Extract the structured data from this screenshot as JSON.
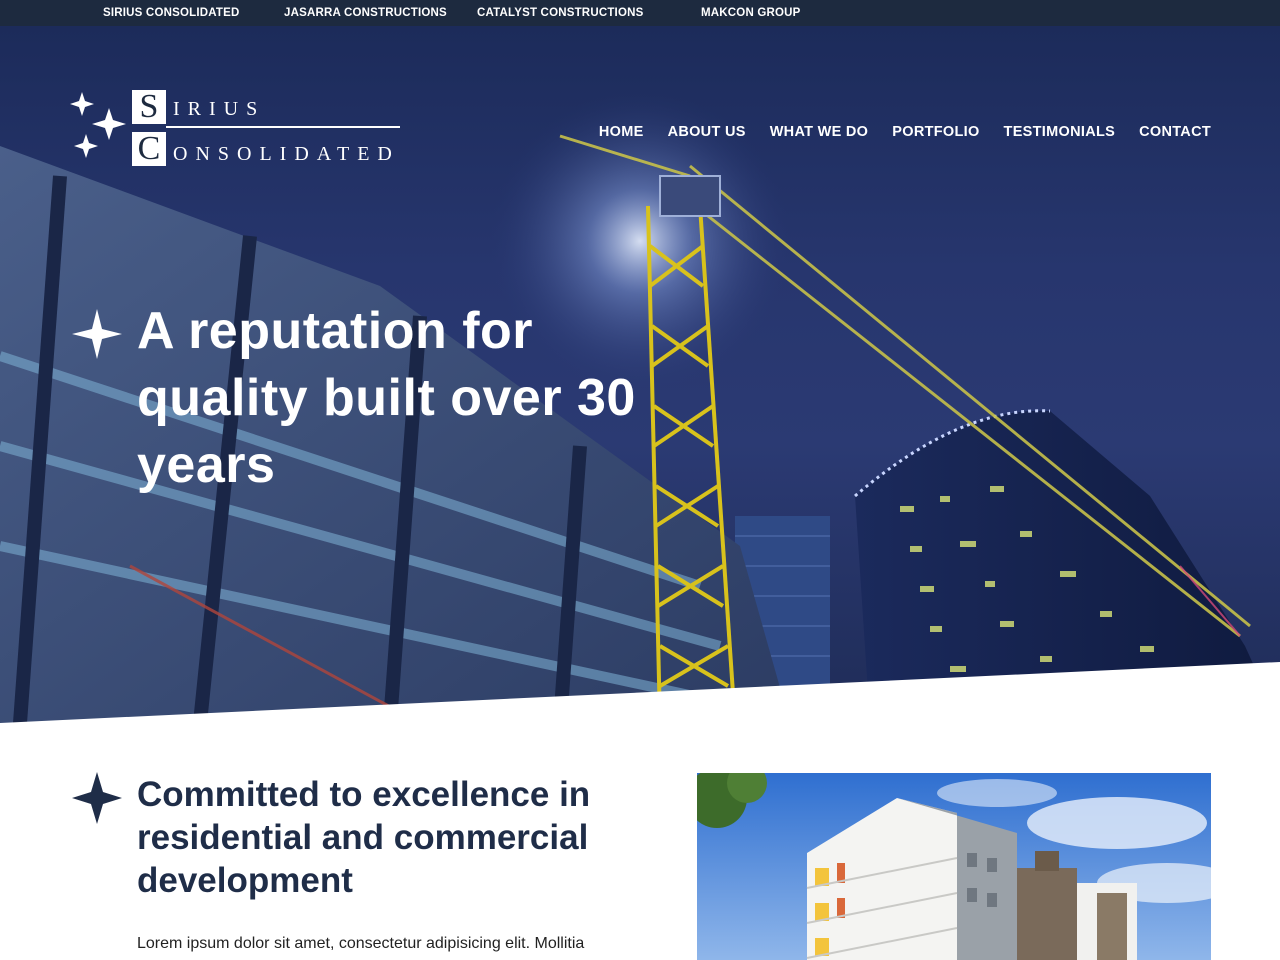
{
  "top_bar": {
    "links": [
      "SIRIUS CONSOLIDATED",
      "JASARRA CONSTRUCTIONS",
      "CATALYST CONSTRUCTIONS",
      "MAKCON GROUP"
    ]
  },
  "logo": {
    "initial_1": "S",
    "word_1": "IRIUS",
    "initial_2": "C",
    "word_2": "ONSOLIDATED"
  },
  "nav": {
    "items": [
      "HOME",
      "ABOUT US",
      "WHAT WE DO",
      "PORTFOLIO",
      "TESTIMONIALS",
      "CONTACT"
    ]
  },
  "hero": {
    "headline": "A reputation for quality built over 30 years"
  },
  "intro": {
    "title": "Committed to excellence in residential and commercial development",
    "text": "Lorem ipsum dolor sit amet, consectetur adipisicing elit. Mollitia"
  },
  "colors": {
    "navy": "#1d2a3f",
    "heading": "#1f2d48",
    "white": "#ffffff",
    "crane_yellow": "#d8c21c"
  },
  "icons": [
    "four-point-star-icon"
  ]
}
